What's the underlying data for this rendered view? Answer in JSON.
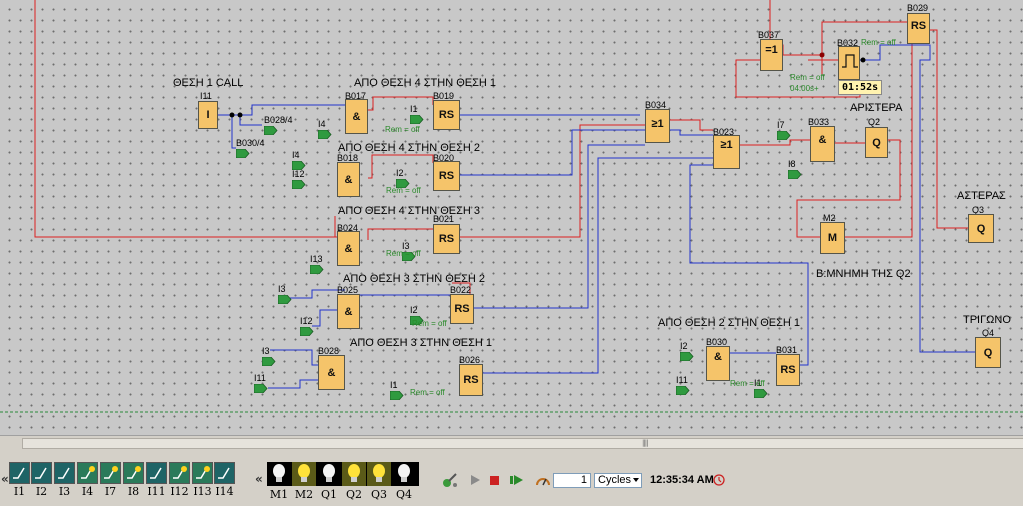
{
  "labels": {
    "thesi1_call": "ΘΕΣΗ 1 CALL",
    "apo4_1": "ΑΠΟ ΘΕΣΗ 4 ΣΤΗΝ ΘΕΣΗ 1",
    "apo4_2": "ΑΠΟ ΘΕΣΗ 4 ΣΤΗΝ ΘΕΣΗ 2",
    "apo4_3": "ΑΠΟ ΘΕΣΗ 4 ΣΤΗΝ ΘΕΣΗ 3",
    "apo3_2": "ΑΠΟ ΘΕΣΗ 3 ΣΤΗΝ ΘΕΣΗ 2",
    "apo3_1": "ΑΠΟ ΘΕΣΗ 3 ΣΤΗΝ ΘΕΣΗ 1",
    "apo2_1": "ΑΠΟ ΘΕΣΗ 2 ΣΤΗΝ ΘΕΣΗ 1",
    "aristera": "ΑΡΙΣΤΕΡΑ",
    "asteras": "ΑΣΤΕΡΑΣ",
    "trigono": "ΤΡΙΓΩΝΟ",
    "mnimi_q2": "Β:ΜΝΗΜΗ ΤΗΣ Q2"
  },
  "blocks": {
    "I11": {
      "id": "I11",
      "sym": "I"
    },
    "B017": {
      "id": "B017",
      "sym": "&"
    },
    "B018": {
      "id": "B018",
      "sym": "&"
    },
    "B024": {
      "id": "B024",
      "sym": "&"
    },
    "B025": {
      "id": "B025",
      "sym": "&"
    },
    "B028": {
      "id": "B028",
      "sym": "&"
    },
    "B030": {
      "id": "B030",
      "sym": "&"
    },
    "B033": {
      "id": "B033",
      "sym": "&"
    },
    "B019": {
      "id": "B019",
      "sym": "RS"
    },
    "B020": {
      "id": "B020",
      "sym": "RS"
    },
    "B021": {
      "id": "B021",
      "sym": "RS"
    },
    "B022": {
      "id": "B022",
      "sym": "RS"
    },
    "B026": {
      "id": "B026",
      "sym": "RS"
    },
    "B031": {
      "id": "B031",
      "sym": "RS"
    },
    "B029": {
      "id": "B029",
      "sym": "RS"
    },
    "B034": {
      "id": "B034",
      "sym": "≥1"
    },
    "B023": {
      "id": "B023",
      "sym": "≥1"
    },
    "B037": {
      "id": "B037",
      "sym": "=1"
    },
    "B032": {
      "id": "B032",
      "sym": ""
    },
    "Q2": {
      "id": "Q2",
      "sym": "Q"
    },
    "Q3": {
      "id": "Q3",
      "sym": "Q"
    },
    "Q4": {
      "id": "Q4",
      "sym": "Q"
    },
    "M2": {
      "id": "M2",
      "sym": "M"
    }
  },
  "flags": {
    "B028_4": "B028/4",
    "B030_4": "B030/4",
    "I4a": "I4",
    "I1a": "I1",
    "I4b": "I4",
    "I12a": "I12",
    "I2a": "I2",
    "I3a": "I3",
    "I13a": "I13",
    "I3b": "I3",
    "I12b": "I12",
    "I2b": "I2",
    "I3c": "I3",
    "I11a": "I11",
    "I1b": "I1",
    "I7a": "I7",
    "I8a": "I8",
    "I2c": "I2",
    "I11b": "I11",
    "I1c": "I1"
  },
  "rem": "Rem = off",
  "timer": {
    "param": "04:00s+",
    "value": "01:52s"
  },
  "sim": {
    "inputs": [
      "I1",
      "I2",
      "I3",
      "I4",
      "I7",
      "I8",
      "I11",
      "I12",
      "I13",
      "I14"
    ],
    "outputs": [
      {
        "label": "M1",
        "on": false
      },
      {
        "label": "M2",
        "on": true
      },
      {
        "label": "Q1",
        "on": false
      },
      {
        "label": "Q2",
        "on": true
      },
      {
        "label": "Q3",
        "on": true
      },
      {
        "label": "Q4",
        "on": false
      }
    ],
    "collapse_left": "«",
    "collapse_mid": "«",
    "cycles_value": "1",
    "cycles_unit": "Cycles",
    "clock": "12:35:34 AM"
  },
  "colors": {
    "wire_blue": "#2233cc",
    "wire_red": "#dd2020",
    "block_fill": "#f5c46a",
    "input_active": "#1e6466"
  }
}
